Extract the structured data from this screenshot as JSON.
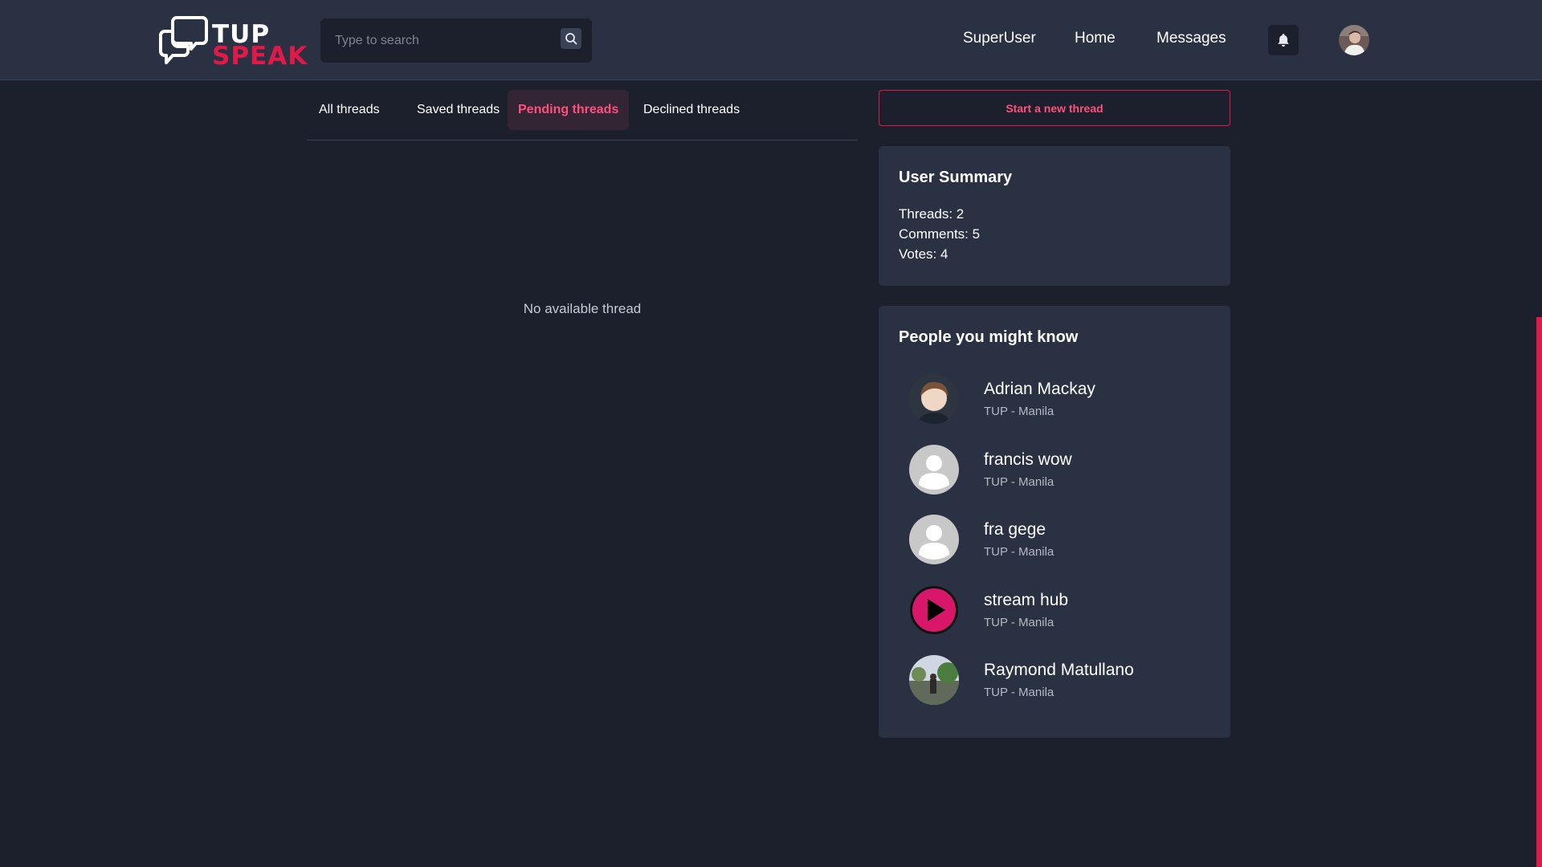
{
  "header": {
    "logo_top": "TUP",
    "logo_bottom": "SPEAK",
    "search": {
      "placeholder": "Type to search"
    },
    "nav": [
      "SuperUser",
      "Home",
      "Messages"
    ]
  },
  "tabs": [
    {
      "label": "All threads",
      "active": false
    },
    {
      "label": "Saved threads",
      "active": false
    },
    {
      "label": "Pending threads",
      "active": true
    },
    {
      "label": "Declined threads",
      "active": false
    }
  ],
  "main": {
    "empty_message": "No available thread"
  },
  "sidebar": {
    "new_thread_label": "Start a new thread",
    "summary": {
      "title": "User Summary",
      "threads": "Threads: 2",
      "comments": "Comments: 5",
      "votes": "Votes: 4"
    },
    "people": {
      "title": "People you might know",
      "list": [
        {
          "name": "Adrian Mackay",
          "location": "TUP - Manila",
          "avatar": "photo-avatar"
        },
        {
          "name": "francis wow",
          "location": "TUP - Manila",
          "avatar": "default-user-icon"
        },
        {
          "name": "fra gege",
          "location": "TUP - Manila",
          "avatar": "default-user-icon"
        },
        {
          "name": "stream hub",
          "location": "TUP - Manila",
          "avatar": "play-icon"
        },
        {
          "name": "Raymond Matullano",
          "location": "TUP - Manila",
          "avatar": "photo-avatar"
        }
      ]
    }
  },
  "colors": {
    "background": "#1b202c",
    "panel": "#2a3142",
    "accent": "#e01948",
    "accent_text": "#ff4f7d"
  }
}
